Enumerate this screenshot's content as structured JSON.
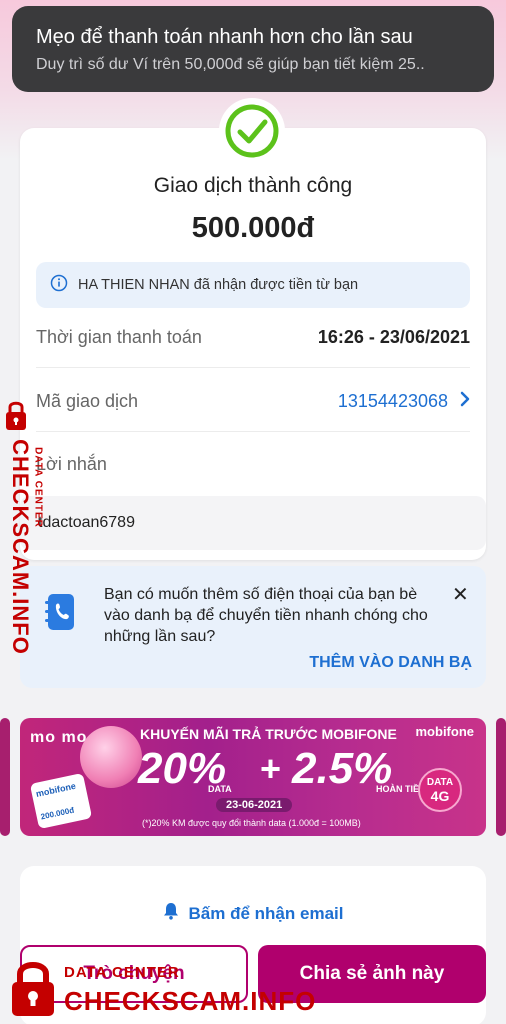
{
  "toast": {
    "title": "Mẹo để thanh toán nhanh hơn cho lần sau",
    "message": "Duy trì số dư Ví trên 50,000đ sẽ giúp bạn tiết kiệm 25.."
  },
  "receipt": {
    "status": "Giao dịch thành công",
    "amount": "500.000đ",
    "info_text": "HA THIEN NHAN đã nhận được tiền từ bạn",
    "time_label": "Thời gian thanh toán",
    "time_value": "16:26 - 23/06/2021",
    "txn_label": "Mã giao dịch",
    "txn_value": "13154423068",
    "message_label": "Lời nhắn",
    "message_value": "tdactoan6789"
  },
  "suggestion": {
    "text": "Bạn có muốn thêm số điện thoại của bạn bè vào danh bạ để chuyển tiền nhanh chóng cho những lần sau?",
    "cta": "THÊM VÀO DANH BẠ"
  },
  "banner": {
    "brand": "mo mo",
    "headline": "KHUYẾN MÃI TRẢ TRƯỚC MOBIFONE",
    "operator": "mobifone",
    "offer1": "20%",
    "offer1_sub": "DATA",
    "plus": "+",
    "offer2": "2.5%",
    "offer2_sub": "HOÀN TIỀN (*)",
    "date": "23-06-2021",
    "fineprint": "(*)20% KM được quy đổi thành data (1.000đ = 100MB)",
    "badge_top": "DATA",
    "badge_bottom": "4G",
    "sim_label": "mobifone",
    "sim_amount": "200.000đ"
  },
  "email_link": "Bấm để nhận email",
  "buttons": {
    "chat": "Trò chuyện",
    "share": "Chia sẻ ảnh này"
  },
  "watermark": {
    "vertical_big": "CHECKSCAM.INFO",
    "vertical_small": "DATA CENTER",
    "bottom_small": "DATA CENTER",
    "bottom_big": "CHECKSCAM.INFO"
  },
  "colors": {
    "brand": "#b0006d",
    "link": "#1e6fd1",
    "success": "#5cc21b",
    "watermark": "#c40000"
  },
  "icons": [
    "check-circle-icon",
    "info-icon",
    "chevron-right-icon",
    "contact-book-icon",
    "close-icon",
    "bell-icon",
    "lock-icon"
  ]
}
